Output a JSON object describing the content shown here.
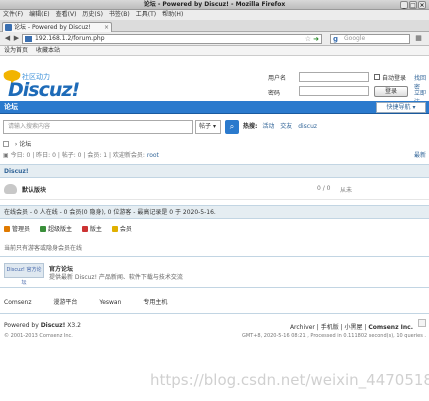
{
  "window": {
    "title": "论坛 - Powered by Discuz! - Mozilla Firefox",
    "min": "_",
    "max": "□",
    "close": "×"
  },
  "menu": [
    "文件(F)",
    "编辑(E)",
    "查看(V)",
    "历史(S)",
    "书签(B)",
    "工具(T)",
    "帮助(H)"
  ],
  "tab": {
    "label": "论坛 - Powered by Discuz!",
    "close": "×"
  },
  "nav": {
    "back": "◀",
    "forward": "▶",
    "url": "192.168.1.2/forum.php",
    "search_placeholder": "Google"
  },
  "bookmarks": [
    "设为首页",
    "收藏本站"
  ],
  "logo": {
    "tagline": "社区动力",
    "brand": "Discuz!"
  },
  "login": {
    "username_label": "用户名",
    "password_label": "密码",
    "autologin_label": "自动登录",
    "forgot_label": "找回密",
    "login_button": "登录",
    "register_label": "立即注"
  },
  "forumbar": {
    "home": "论坛",
    "quick_nav": "快捷导航"
  },
  "searchbar": {
    "placeholder": "请输入搜索内容",
    "scope": "帖子",
    "hot_label": "热搜:",
    "hot_terms": [
      "活动",
      "交友",
      "discuz"
    ]
  },
  "breadcrumb": {
    "current": "论坛"
  },
  "stats": {
    "text": "今日: 0 | 昨日: 0 | 帖子: 0 | 会员: 1 | 欢迎新会员: ",
    "newest_member": "root",
    "latest_link": "最新"
  },
  "category": {
    "title": "Discuz!"
  },
  "forum": {
    "name": "默认版块",
    "counts": "0 / 0",
    "last_post": "从未"
  },
  "online": {
    "summary": "在线会员 - 0 人在线 - 0 会员(0 隐身), 0 位游客 - 最高记录是 0 于 2020-5-16.",
    "legend": [
      "管理员",
      "超级版主",
      "版主",
      "会员"
    ],
    "legend_colors": [
      "#e07a00",
      "#3a8f3a",
      "#cc3333",
      "#e0b000"
    ],
    "empty": "当前只有游客或隐身会员在线"
  },
  "official": {
    "logo_text": "Discuz! 官方论坛",
    "title": "官方论坛",
    "desc": "提供最新 Discuz! 产品新闻、软件下载与技术交流"
  },
  "links": [
    "Comsenz",
    "漫游平台",
    "Yeswan",
    "专用主机"
  ],
  "footer": {
    "powered_prefix": "Powered by",
    "powered_brand": "Discuz!",
    "version": "X3.2",
    "copyright": "© 2001-2013 Comsenz Inc.",
    "right_links": "Archiver | 手机版 | 小黑屋 | ",
    "company": "Comsenz Inc.",
    "timing": "GMT+8, 2020-5-16 08:21 , Processed in 0.111802 second(s), 10 queries ."
  },
  "watermark": "https://blog.csdn.net/weixin_44705186"
}
